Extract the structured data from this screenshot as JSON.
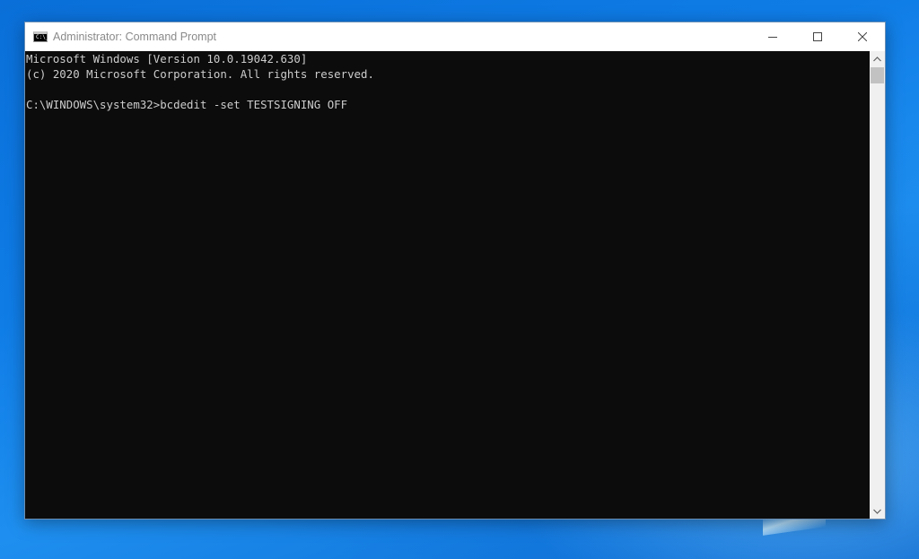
{
  "window": {
    "title": "Administrator: Command Prompt",
    "app_icon_label": "C:\\_"
  },
  "console": {
    "lines": [
      "Microsoft Windows [Version 10.0.19042.630]",
      "(c) 2020 Microsoft Corporation. All rights reserved.",
      "",
      "C:\\WINDOWS\\system32>bcdedit -set TESTSIGNING OFF"
    ]
  },
  "icons": {
    "minimize": "minimize-icon",
    "maximize": "maximize-icon",
    "close": "close-icon",
    "scroll_up": "chevron-up-icon",
    "scroll_down": "chevron-down-icon"
  },
  "colors": {
    "console_bg": "#0c0c0c",
    "console_text": "#cccccc",
    "titlebar_bg": "#ffffff",
    "desktop_accent": "#0f7ce6"
  }
}
